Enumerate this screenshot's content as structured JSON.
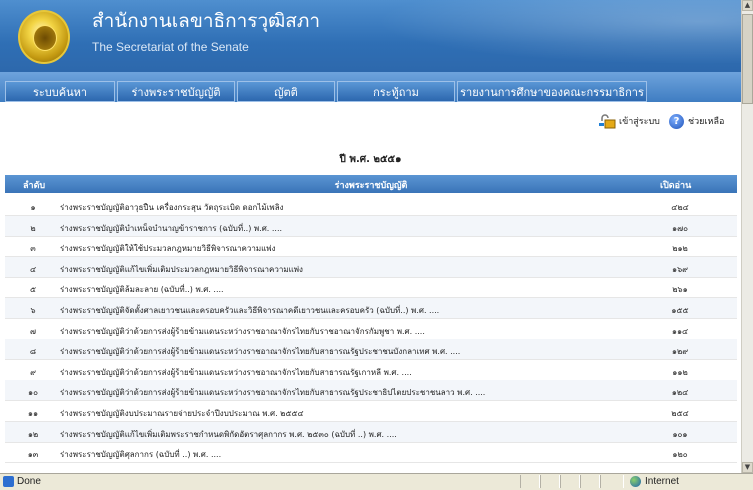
{
  "header": {
    "title": "สำนักงานเลขาธิการวุฒิสภา",
    "subtitle": "The Secretariat of the Senate"
  },
  "nav": {
    "items": [
      "ระบบค้นหา",
      "ร่างพระราชบัญญัติ",
      "ญัตติ",
      "กระทู้ถาม",
      "รายงานการศึกษาของคณะกรรมาธิการ"
    ]
  },
  "tools": {
    "login_label": "เข้าสู่ระบบ",
    "help_label": "ช่วยเหลือ"
  },
  "year_title": "ปี พ.ศ. ๒๕๕๑",
  "table": {
    "headers": {
      "no": "ลำดับ",
      "name": "ร่างพระราชบัญญัติ",
      "views": "เปิดอ่าน"
    },
    "rows": [
      {
        "no": "๑",
        "name": "ร่างพระราชบัญญัติอาวุธปืน เครื่องกระสุน วัตถุระเบิด ดอกไม้เพลิง",
        "views": "๔๒๔"
      },
      {
        "no": "๒",
        "name": "ร่างพระราชบัญญัติบำเหน็จบำนาญข้าราชการ (ฉบับที่..) พ.ศ. ....",
        "views": "๑๗๐"
      },
      {
        "no": "๓",
        "name": "ร่างพระราชบัญญัติให้ใช้ประมวลกฎหมายวิธีพิจารณาความแพ่ง",
        "views": "๒๑๒"
      },
      {
        "no": "๔",
        "name": "ร่างพระราชบัญญัติแก้ไขเพิ่มเติมประมวลกฎหมายวิธีพิจารณาความแพ่ง",
        "views": "๑๖๙"
      },
      {
        "no": "๕",
        "name": "ร่างพระราชบัญญัติล้มละลาย (ฉบับที่..) พ.ศ. ....",
        "views": "๒๖๑"
      },
      {
        "no": "๖",
        "name": "ร่างพระราชบัญญัติจัดตั้งศาลเยาวชนและครอบครัวและวิธีพิจารณาคดีเยาวชนและครอบครัว (ฉบับที่..) พ.ศ. ....",
        "views": "๑๕๕"
      },
      {
        "no": "๗",
        "name": "ร่างพระราชบัญญัติว่าด้วยการส่งผู้ร้ายข้ามแดนระหว่างราชอาณาจักรไทยกับราชอาณาจักรกัมพูชา พ.ศ. ....",
        "views": "๑๑๔"
      },
      {
        "no": "๘",
        "name": "ร่างพระราชบัญญัติว่าด้วยการส่งผู้ร้ายข้ามแดนระหว่างราชอาณาจักรไทยกับสาธารณรัฐประชาชนบังกลาเทศ พ.ศ. ....",
        "views": "๑๒๙"
      },
      {
        "no": "๙",
        "name": "ร่างพระราชบัญญัติว่าด้วยการส่งผู้ร้ายข้ามแดนระหว่างราชอาณาจักรไทยกับสาธารณรัฐเกาหลี พ.ศ. ....",
        "views": "๑๑๒"
      },
      {
        "no": "๑๐",
        "name": "ร่างพระราชบัญญัติว่าด้วยการส่งผู้ร้ายข้ามแดนระหว่างราชอาณาจักรไทยกับสาธารณรัฐประชาธิปไตยประชาชนลาว พ.ศ. ....",
        "views": "๑๒๔"
      },
      {
        "no": "๑๑",
        "name": "ร่างพระราชบัญญัติงบประมาณรายจ่ายประจำปีงบประมาณ พ.ศ. ๒๕๕๔",
        "views": "๒๕๔"
      },
      {
        "no": "๑๒",
        "name": "ร่างพระราชบัญญัติแก้ไขเพิ่มเติมพระราชกำหนดพิกัดอัตราศุลกากร พ.ศ. ๒๕๓๐ (ฉบับที่ ..) พ.ศ. ....",
        "views": "๑๐๑"
      },
      {
        "no": "๑๓",
        "name": "ร่างพระราชบัญญัติศุลกากร (ฉบับที่ ..) พ.ศ. ....",
        "views": "๑๒๐"
      }
    ]
  },
  "statusbar": {
    "status": "Done",
    "zone": "Internet"
  },
  "colors": {
    "header_blue": "#2f6fb5",
    "nav_blue": "#3f7dc2",
    "table_header_blue": "#3a74b8"
  }
}
